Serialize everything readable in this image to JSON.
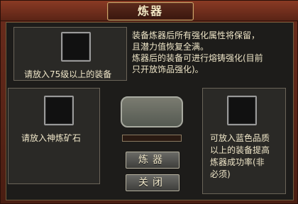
{
  "window": {
    "title": "炼器"
  },
  "equipment": {
    "label": "请放入75级以上的装备"
  },
  "info": {
    "lines": [
      "装备炼器后所有强化属性将保留，",
      "且潜力值恢复全满。",
      "炼器后的装备可进行熔铸强化(目前",
      "只开放饰品强化)。"
    ]
  },
  "ore": {
    "label": "请放入神炼矿石"
  },
  "booster": {
    "lines": [
      "可放入蓝色品质",
      "以上的装备提高",
      "炼器成功率(非",
      "必须)"
    ]
  },
  "progress": {
    "fraction": 0
  },
  "buttons": {
    "refine": "炼器",
    "close": "关闭"
  }
}
